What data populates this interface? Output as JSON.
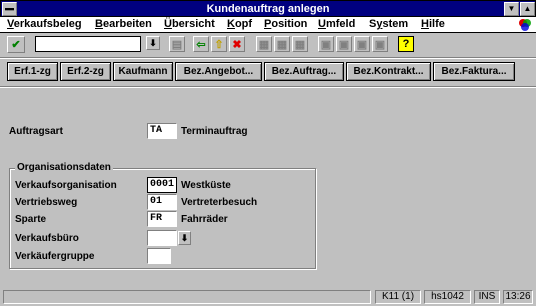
{
  "window": {
    "title": "Kundenauftrag anlegen"
  },
  "menu": [
    {
      "pre": "",
      "u": "V",
      "post": "erkaufsbeleg"
    },
    {
      "pre": "",
      "u": "B",
      "post": "earbeiten"
    },
    {
      "pre": "",
      "u": "Ü",
      "post": "bersicht"
    },
    {
      "pre": "",
      "u": "K",
      "post": "opf"
    },
    {
      "pre": "",
      "u": "P",
      "post": "osition"
    },
    {
      "pre": "",
      "u": "U",
      "post": "mfeld"
    },
    {
      "pre": "S",
      "u": "y",
      "post": "stem"
    },
    {
      "pre": "",
      "u": "H",
      "post": "ilfe"
    }
  ],
  "toolbar": {
    "command_value": "",
    "icons": [
      "enter-checkmark-icon",
      "dropdown-arrow-icon",
      "save-icon",
      "back-arrow-icon",
      "exit-up-arrow-icon",
      "cancel-x-icon",
      "print-icon",
      "find-icon",
      "find-next-icon",
      "first-page-icon",
      "prev-page-icon",
      "next-page-icon",
      "last-page-icon",
      "help-icon"
    ]
  },
  "buttons": [
    {
      "label": "Erf.1-zg"
    },
    {
      "label": "Erf.2-zg"
    },
    {
      "label": "Kaufmann"
    },
    {
      "label": "Bez.Angebot..."
    },
    {
      "label": "Bez.Auftrag..."
    },
    {
      "label": "Bez.Kontrakt..."
    },
    {
      "label": "Bez.Faktura..."
    }
  ],
  "form": {
    "auftragsart": {
      "label": "Auftragsart",
      "value": "TA",
      "desc": "Terminauftrag"
    },
    "group_title": "Organisationsdaten",
    "vkorg": {
      "label": "Verkaufsorganisation",
      "value": "0001",
      "desc": "Westküste"
    },
    "vtweg": {
      "label": "Vertriebsweg",
      "value": "01",
      "desc": "Vertreterbesuch"
    },
    "sparte": {
      "label": "Sparte",
      "value": "FR",
      "desc": "Fahrräder"
    },
    "vkbur": {
      "label": "Verkaufsbüro",
      "value": ""
    },
    "vkgrp": {
      "label": "Verkäufergruppe",
      "value": ""
    }
  },
  "status": {
    "system": "K11 (1)",
    "server": "hs1042",
    "mode": "INS",
    "time": "13:26"
  }
}
